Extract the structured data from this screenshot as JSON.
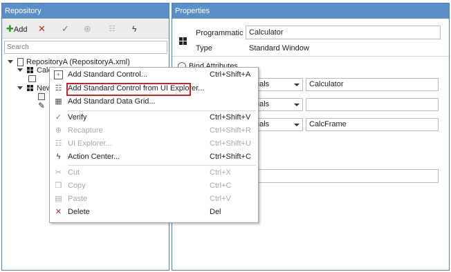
{
  "repository": {
    "title": "Repository",
    "toolbar": {
      "add_label": "Add"
    },
    "search_placeholder": "Search",
    "tree": {
      "root": "RepositoryA (RepositoryA.xml)",
      "item1": "Calculator",
      "item2": "New"
    }
  },
  "properties": {
    "title": "Properties",
    "programmatic_id_label": "Programmatic Id",
    "programmatic_id_value": "Calculator",
    "type_label": "Type",
    "type_value": "Standard Window",
    "bind_attributes_label": "Bind Attributes",
    "rows": [
      {
        "operator": "uals",
        "value": "Calculator"
      },
      {
        "operator": "uals",
        "value": ""
      },
      {
        "operator": "uals",
        "value": "CalcFrame"
      }
    ]
  },
  "context_menu": {
    "items": [
      {
        "label": "Add Standard Control...",
        "shortcut": "Ctrl+Shift+A",
        "icon": "add-control-icon"
      },
      {
        "label": "Add Standard Control from UI Explorer...",
        "shortcut": "",
        "icon": "add-from-explorer-icon"
      },
      {
        "label": "Add Standard Data Grid...",
        "shortcut": "",
        "icon": "data-grid-icon"
      },
      {
        "label": "Verify",
        "shortcut": "Ctrl+Shift+V",
        "icon": "verify-check-icon"
      },
      {
        "label": "Recapture",
        "shortcut": "Ctrl+Shift+R",
        "icon": "recapture-icon"
      },
      {
        "label": "UI Explorer...",
        "shortcut": "Ctrl+Shift+U",
        "icon": "ui-explorer-icon"
      },
      {
        "label": "Action Center...",
        "shortcut": "Ctrl+Shift+C",
        "icon": "lightning-icon"
      },
      {
        "label": "Cut",
        "shortcut": "Ctrl+X",
        "icon": "scissors-icon"
      },
      {
        "label": "Copy",
        "shortcut": "Ctrl+C",
        "icon": "copy-icon"
      },
      {
        "label": "Paste",
        "shortcut": "Ctrl+V",
        "icon": "paste-icon"
      },
      {
        "label": "Delete",
        "shortcut": "Del",
        "icon": "delete-x-icon"
      }
    ]
  },
  "colors": {
    "header_blue": "#5b8fc7",
    "green": "#3a9a3a",
    "red": "#d21f1f"
  }
}
